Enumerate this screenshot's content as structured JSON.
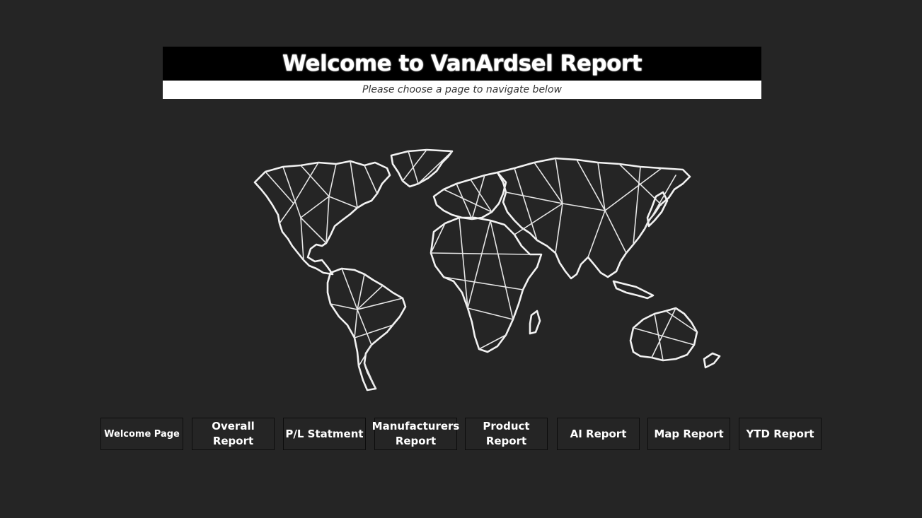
{
  "header": {
    "title": "Welcome to VanArdsel Report",
    "subtitle": "Please choose a page to navigate below"
  },
  "map": {
    "icon": "world-map-icon",
    "background": "#252525",
    "stroke": "#ffffff"
  },
  "nav": {
    "buttons": [
      {
        "label": "Welcome Page"
      },
      {
        "label": "Overall Report"
      },
      {
        "label": "P/L Statment"
      },
      {
        "label": "Manufacturers Report"
      },
      {
        "label": "Product Report"
      },
      {
        "label": "AI Report"
      },
      {
        "label": "Map Report"
      },
      {
        "label": "YTD Report"
      }
    ]
  },
  "colors": {
    "page_background": "#252525",
    "title_background": "#000000",
    "subtitle_background": "#ffffff",
    "button_border": "#0c0c0c"
  }
}
